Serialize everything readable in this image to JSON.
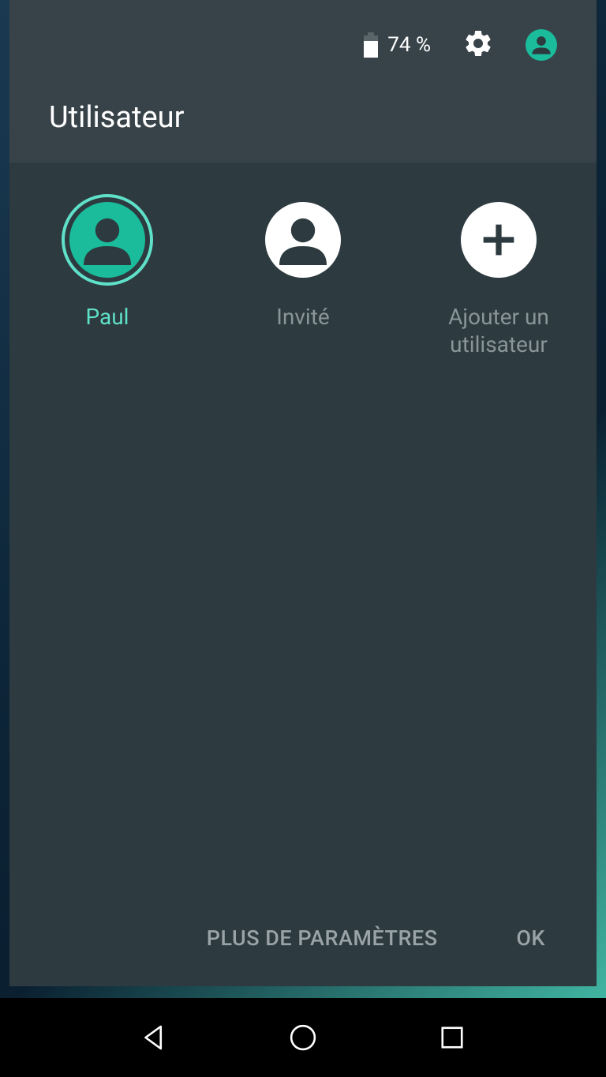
{
  "status": {
    "battery_percent": "74 %"
  },
  "panel": {
    "title": "Utilisateur"
  },
  "users": [
    {
      "label": "Paul",
      "active": true,
      "type": "user"
    },
    {
      "label": "Invité",
      "active": false,
      "type": "guest"
    },
    {
      "label": "Ajouter un utilisateur",
      "active": false,
      "type": "add"
    }
  ],
  "footer": {
    "more_settings": "PLUS DE PARAMÈTRES",
    "ok": "OK"
  },
  "colors": {
    "accent": "#1abc9c",
    "accent_light": "#5fe0c8",
    "panel_dark": "#2d3a3f",
    "header_dark": "#384349",
    "text_muted": "#8a9599"
  }
}
